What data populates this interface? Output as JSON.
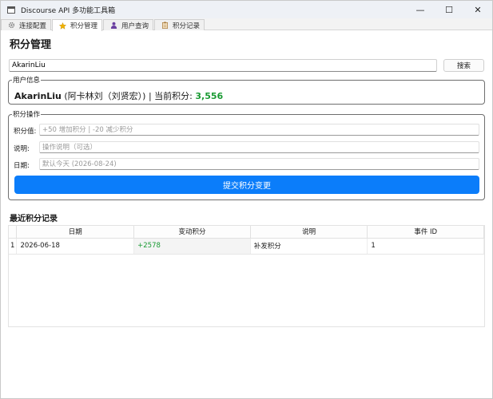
{
  "window": {
    "title": "Discourse API 多功能工具箱",
    "minimize": "—",
    "maximize": "☐",
    "close": "✕"
  },
  "tabs": [
    {
      "label": "连接配置",
      "icon": "gear-icon"
    },
    {
      "label": "积分管理",
      "icon": "star-icon"
    },
    {
      "label": "用户查询",
      "icon": "person-icon"
    },
    {
      "label": "积分记录",
      "icon": "clipboard-icon"
    }
  ],
  "page": {
    "title": "积分管理"
  },
  "search": {
    "value": "AkarinLiu",
    "button": "搜索"
  },
  "user_info": {
    "legend": "用户信息",
    "username": "AkarinLiu",
    "display": " (阿卡林刘（刘贤宏）) | 当前积分: ",
    "points": "3,556"
  },
  "ops": {
    "legend": "积分操作",
    "points_label": "积分值:",
    "points_placeholder": "+50 增加积分 | -20 减少积分",
    "desc_label": "说明:",
    "desc_placeholder": "操作说明（可选）",
    "date_label": "日期:",
    "date_placeholder": "默认今天 (2026-08-24)",
    "submit": "提交积分变更"
  },
  "records": {
    "title": "最近积分记录",
    "columns": [
      "日期",
      "变动积分",
      "说明",
      "事件 ID"
    ],
    "rows": [
      {
        "num": "1",
        "date": "2026-06-18",
        "change": "+2578",
        "desc": "补发积分",
        "event_id": "1"
      }
    ]
  },
  "colors": {
    "accent": "#0b7dfa",
    "positive": "#1a9a33"
  }
}
